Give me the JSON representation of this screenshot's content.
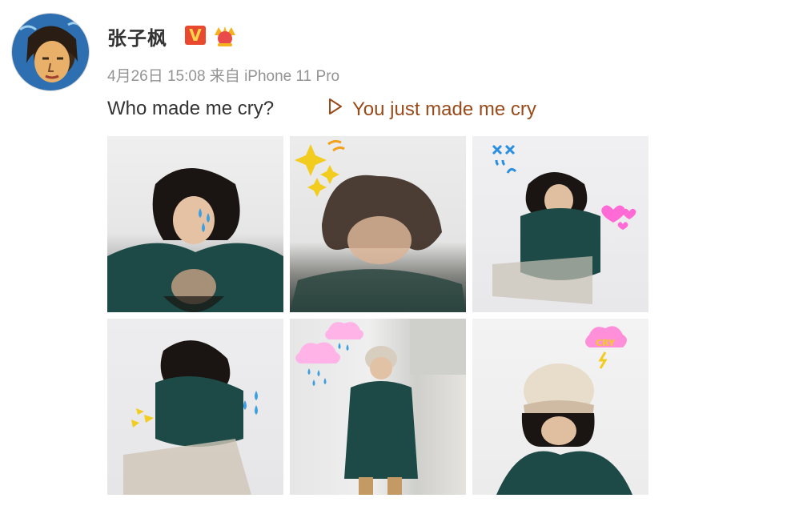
{
  "post": {
    "author_name": "张子枫",
    "verified_badge": "V",
    "crown_icon": "crown-icon",
    "meta": "4月26日 15:08 来自 iPhone 11 Pro",
    "text": "Who made me cry?",
    "video_link_label": "You just made me cry",
    "video_link_icon": "play-triangle-icon"
  },
  "gallery": {
    "count": 6,
    "stickers": [
      "tear-drops",
      "sparkle-stars",
      "angry-face-marks",
      "pink-hearts",
      "lightning-sparks",
      "rain-clouds",
      "cry-cloud"
    ]
  },
  "colors": {
    "link": "#9a4a1a",
    "meta": "#939393",
    "badge_red": "#e8492f",
    "badge_gold": "#ffd34a"
  },
  "sticker_texts": {
    "cry": "CRY"
  }
}
